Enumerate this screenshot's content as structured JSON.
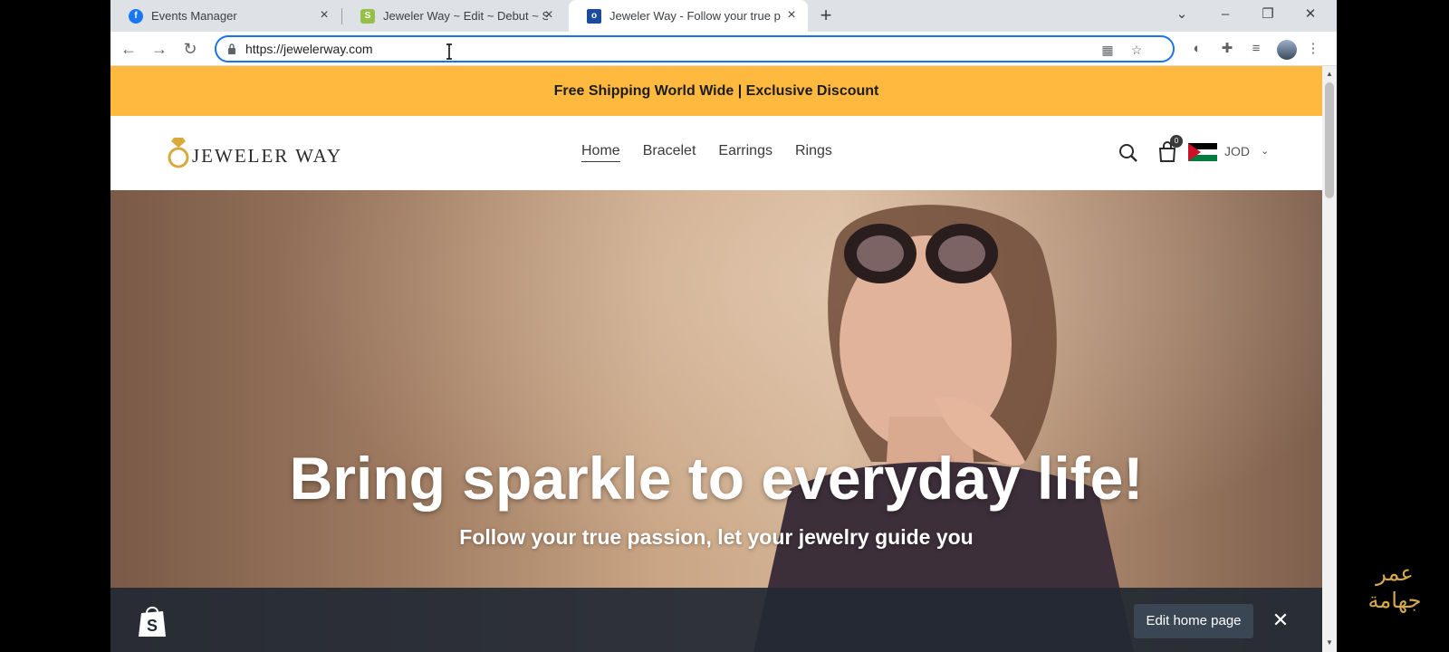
{
  "browser": {
    "tabs": [
      {
        "title": "Events Manager",
        "favicon": "facebook-icon",
        "color": "#1877f2",
        "active": false
      },
      {
        "title": "Jeweler Way ~ Edit ~ Debut ~ Sh",
        "favicon": "shopify-icon",
        "color": "#95bf47",
        "active": false
      },
      {
        "title": "Jeweler Way - Follow your true p",
        "favicon": "ring-icon",
        "color": "#1a4c9a",
        "active": true
      }
    ],
    "url": "https://jewelerway.com"
  },
  "announcement": {
    "text": "Free Shipping World Wide | Exclusive Discount",
    "color": "#ffb93e"
  },
  "header": {
    "logo_text": "JEWELER WAY",
    "nav": [
      "Home",
      "Bracelet",
      "Earrings",
      "Rings"
    ],
    "cart_count": "0",
    "currency": "JOD"
  },
  "hero": {
    "heading": "Bring sparkle to everyday life!",
    "subheading": "Follow your true passion, let your jewelry guide you"
  },
  "admin_bar": {
    "edit_label": "Edit home page"
  },
  "watermark": {
    "line1": "عمر",
    "line2": "جهامة"
  }
}
